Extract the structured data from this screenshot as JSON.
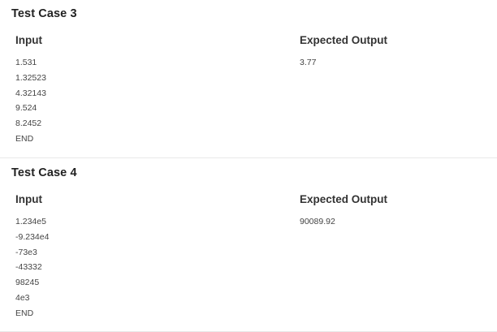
{
  "labels": {
    "input_header": "Input",
    "expected_header": "Expected Output"
  },
  "test_cases": [
    {
      "title": "Test Case 3",
      "input_lines": [
        "1.531",
        "1.32523",
        "4.32143",
        "9.524",
        "8.2452",
        "END"
      ],
      "expected_lines": [
        "3.77"
      ]
    },
    {
      "title": "Test Case 4",
      "input_lines": [
        "1.234e5",
        "-9.234e4",
        "-73e3",
        "-43332",
        "98245",
        "4e3",
        "END"
      ],
      "expected_lines": [
        "90089.92"
      ]
    }
  ]
}
